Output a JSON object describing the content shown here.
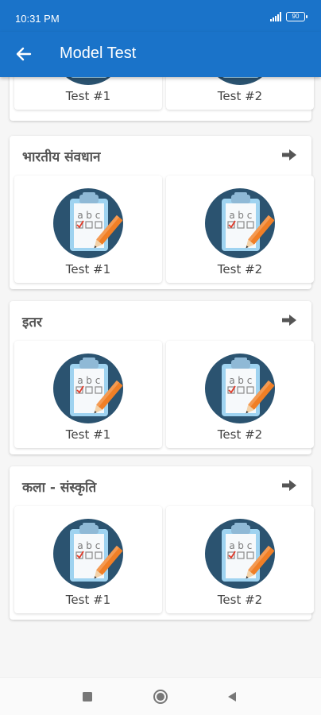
{
  "status_bar": {
    "time": "10:31 PM",
    "battery": "90"
  },
  "app_bar": {
    "title": "Model Test"
  },
  "sections": [
    {
      "title": "",
      "tests": [
        "Test #1",
        "Test #2"
      ]
    },
    {
      "title": "भारतीय संवधान",
      "tests": [
        "Test #1",
        "Test #2"
      ]
    },
    {
      "title": "इतर",
      "tests": [
        "Test #1",
        "Test #2"
      ]
    },
    {
      "title": "कला - संस्कृति",
      "tests": [
        "Test #1",
        "Test #2"
      ]
    }
  ],
  "icon_letters": [
    "a",
    "b",
    "c"
  ],
  "colors": {
    "primary": "#1a73c9",
    "icon_circle": "#2b5370",
    "pencil": "#f07f26"
  }
}
